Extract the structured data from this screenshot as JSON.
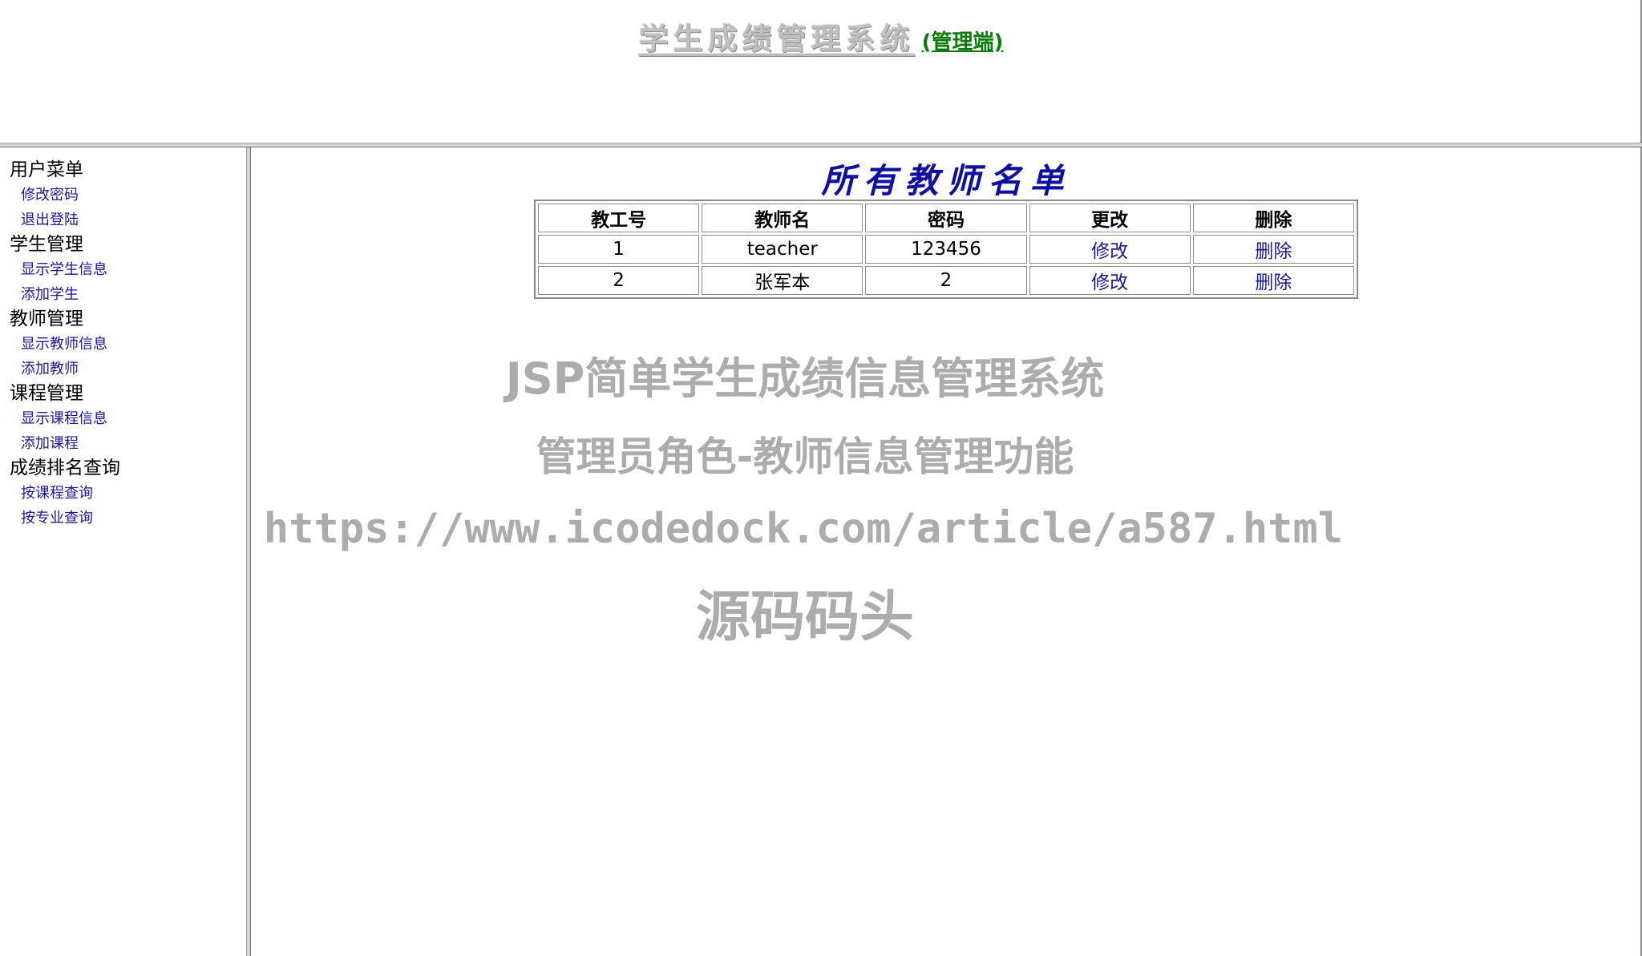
{
  "header": {
    "title": "学生成绩管理系统",
    "subtitle": "(管理端)"
  },
  "sidebar": {
    "groups": [
      {
        "title": "用户菜单",
        "items": [
          {
            "label": "修改密码"
          },
          {
            "label": "退出登陆"
          }
        ]
      },
      {
        "title": "学生管理",
        "items": [
          {
            "label": "显示学生信息"
          },
          {
            "label": "添加学生"
          }
        ]
      },
      {
        "title": "教师管理",
        "items": [
          {
            "label": "显示教师信息"
          },
          {
            "label": "添加教师"
          }
        ]
      },
      {
        "title": "课程管理",
        "items": [
          {
            "label": "显示课程信息"
          },
          {
            "label": "添加课程"
          }
        ]
      },
      {
        "title": "成绩排名查询",
        "items": [
          {
            "label": "按课程查询"
          },
          {
            "label": "按专业查询"
          }
        ]
      }
    ]
  },
  "main": {
    "heading": "所有教师名单",
    "table": {
      "columns": [
        "教工号",
        "教师名",
        "密码",
        "更改",
        "删除"
      ],
      "rows": [
        {
          "id": "1",
          "name": "teacher",
          "password": "123456",
          "edit": "修改",
          "delete": "删除"
        },
        {
          "id": "2",
          "name": "张军本",
          "password": "2",
          "edit": "修改",
          "delete": "删除"
        }
      ]
    }
  },
  "watermark": {
    "line1": "JSP简单学生成绩信息管理系统",
    "line2": "管理员角色-教师信息管理功能",
    "line3": "https://www.icodedock.com/article/a587.html",
    "line4": "源码码头"
  },
  "colors": {
    "title_gray": "#bfbfbf",
    "subtitle_green": "#0b7a0b",
    "link_blue": "#1a1a8f",
    "heading_blue": "#1010a0",
    "watermark_gray": "#acacac"
  }
}
